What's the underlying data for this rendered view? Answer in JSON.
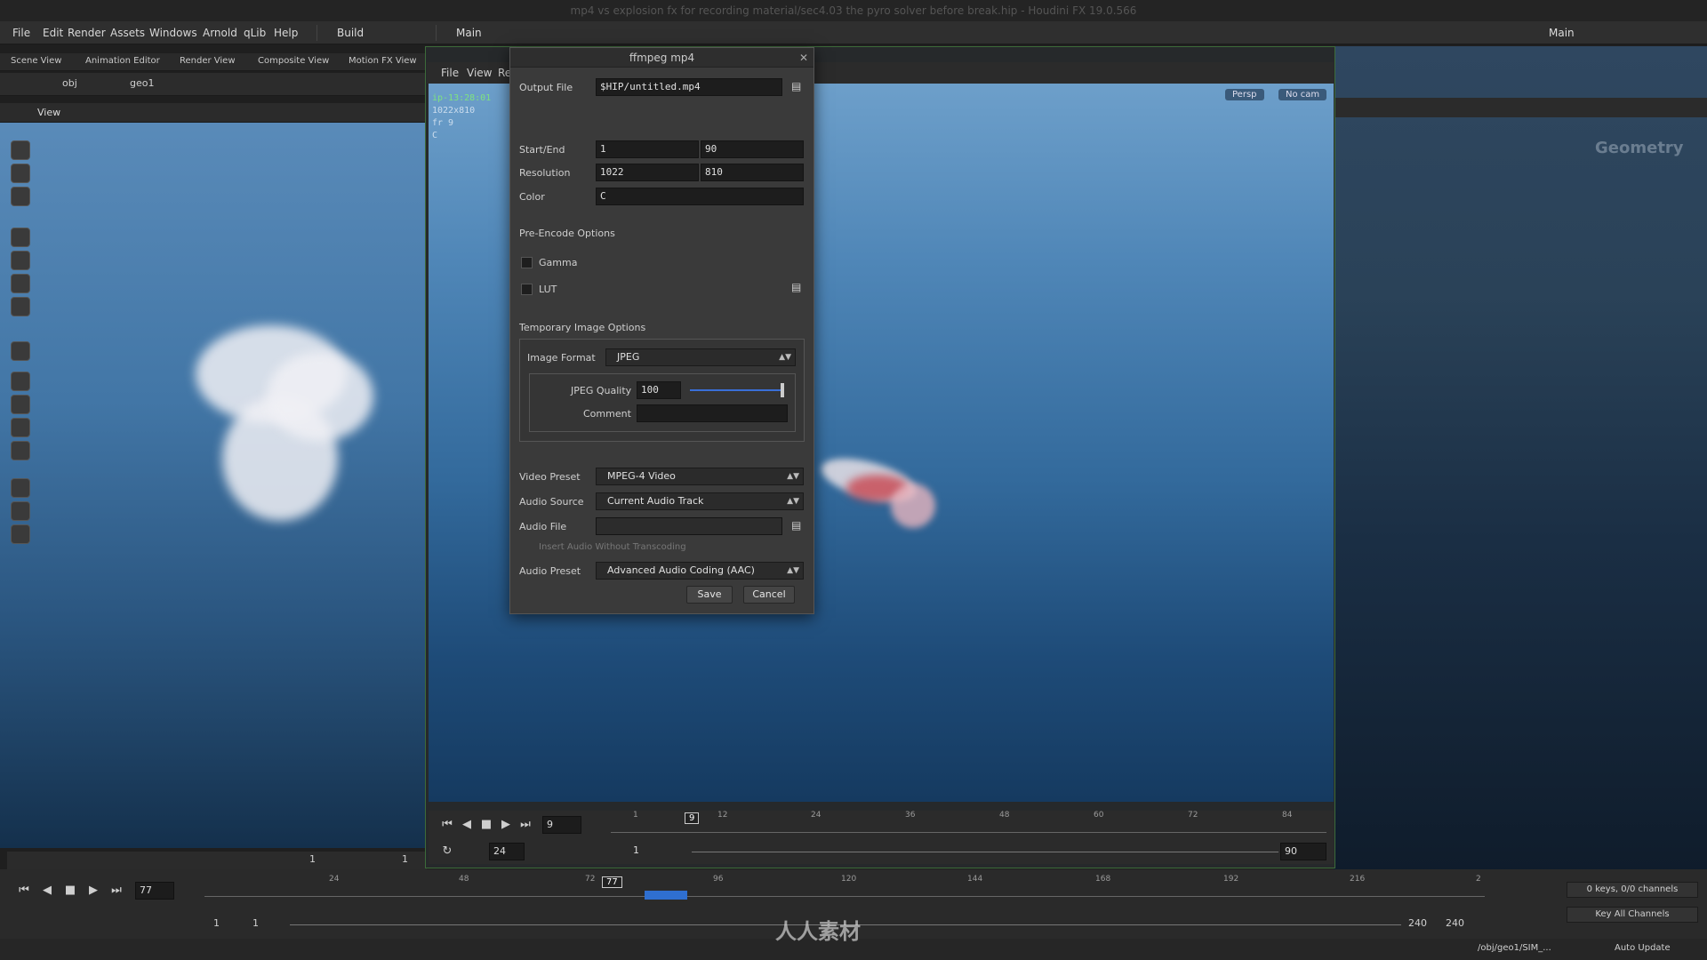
{
  "window": {
    "title": "mp4 vs explosion fx for recording material/sec4.03 the pyro solver before break.hip - Houdini FX 19.0.566"
  },
  "menubar": {
    "items": [
      "File",
      "Edit",
      "Render",
      "Assets",
      "Windows",
      "Arnold",
      "qLib",
      "Help"
    ],
    "desktop": "Build",
    "desk_main": "Main",
    "right_desk": "Main"
  },
  "left": {
    "tabs": [
      "Scene View",
      "Animation Editor",
      "Render View",
      "Composite View",
      "Motion FX View"
    ],
    "path": [
      "obj",
      "geo1"
    ],
    "view_label": "View",
    "bottom_field": "1",
    "bottom_field2": "1"
  },
  "viewer": {
    "menu": [
      "File",
      "View",
      "Re"
    ],
    "info": [
      "ip-13:28:01",
      "1022x810",
      "fr 9",
      "C"
    ],
    "persp": "Persp",
    "cam": "No cam"
  },
  "right": {
    "context": "Geometry"
  },
  "dialog": {
    "title": "ffmpeg mp4",
    "output_file_label": "Output File",
    "output_file": "$HIP/untitled.mp4",
    "startend_label": "Start/End",
    "start": "1",
    "end": "90",
    "resolution_label": "Resolution",
    "res_x": "1022",
    "res_y": "810",
    "color_label": "Color",
    "color": "C",
    "preencode_label": "Pre-Encode Options",
    "gamma_label": "Gamma",
    "lut_label": "LUT",
    "temp_label": "Temporary Image Options",
    "image_format_label": "Image Format",
    "image_format": "JPEG",
    "jpeg_quality_label": "JPEG Quality",
    "jpeg_quality": "100",
    "jpeg_quality_fraction": 1.0,
    "comment_label": "Comment",
    "video_preset_label": "Video Preset",
    "video_preset": "MPEG-4 Video",
    "audio_source_label": "Audio Source",
    "audio_source": "Current Audio Track",
    "audio_file_label": "Audio File",
    "insert_audio_label": "Insert Audio Without Transcoding",
    "audio_preset_label": "Audio Preset",
    "audio_preset": "Advanced Audio Coding (AAC)",
    "save": "Save",
    "cancel": "Cancel"
  },
  "viewer_playbar": {
    "frame": "9",
    "fps": "24",
    "range_start": "1",
    "range_end": "90",
    "ticks": [
      "1",
      "12",
      "24",
      "36",
      "48",
      "60",
      "72",
      "84"
    ],
    "current": "9"
  },
  "main_playbar": {
    "frame": "77",
    "ticks": [
      "24",
      "48",
      "72",
      "96",
      "120",
      "144",
      "168",
      "192",
      "216",
      "2"
    ],
    "current": "77",
    "start": "1",
    "start2": "1",
    "end": "240",
    "end2": "240",
    "keys": "0 keys, 0/0 channels",
    "key_all": "Key All Channels"
  },
  "status": {
    "path": "/obj/geo1/SIM_...",
    "auto_update": "Auto Update"
  },
  "footer_logo": "人人素材",
  "colors": {
    "accent": "#3a6fd8",
    "viewer_border": "#3d6b3a",
    "sky_top": "#6d9fca",
    "sky_bottom": "#153a60"
  },
  "icons": [
    "file-browse-icon",
    "close-icon",
    "play-icon",
    "stop-icon",
    "step-forward-icon",
    "step-back-icon",
    "skip-to-end-icon",
    "skip-to-start-icon"
  ]
}
